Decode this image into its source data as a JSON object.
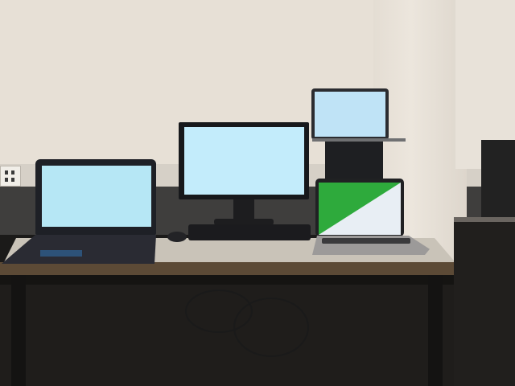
{
  "scene": {
    "colors": {
      "wall": "#e7e0d6",
      "desk_top": "#c9c3b8",
      "screen_blank": "#c3ecfb",
      "screen_green": "#2eaa3c",
      "screen_white": "#e8eef4"
    },
    "objects": [
      {
        "name": "left-laptop",
        "screen": "light-blue"
      },
      {
        "name": "center-monitor",
        "screen": "light-blue"
      },
      {
        "name": "top-right-laptop",
        "screen": "light-blue"
      },
      {
        "name": "right-laptop",
        "screen": "green-white-diagonal"
      },
      {
        "name": "keyboard"
      },
      {
        "name": "mouse"
      }
    ]
  }
}
